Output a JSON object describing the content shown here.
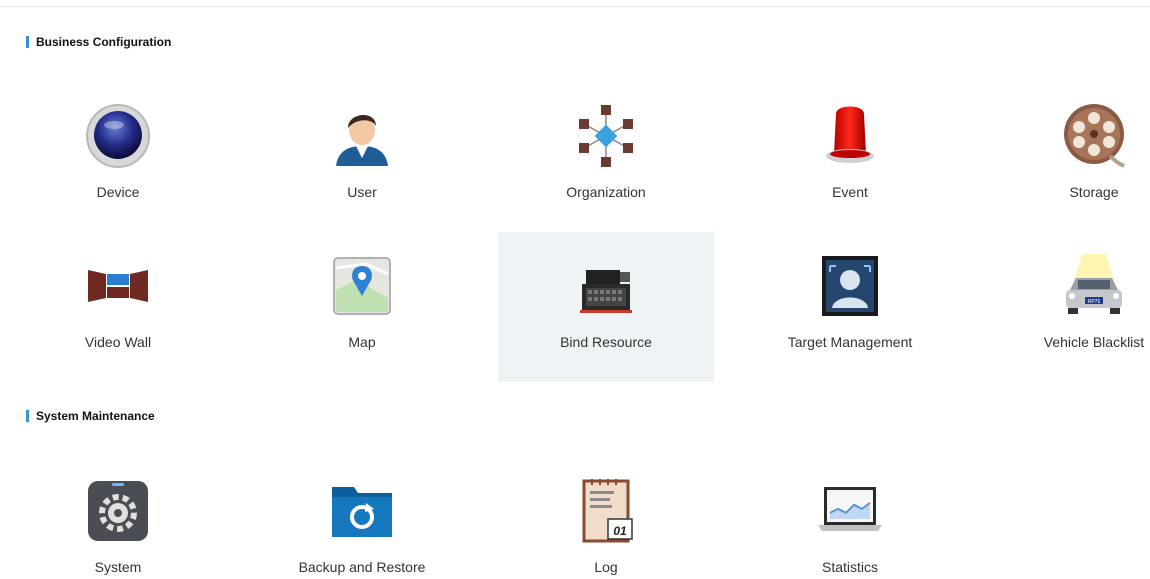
{
  "sections": {
    "business": {
      "title": "Business Configuration",
      "items": [
        {
          "label": "Device",
          "icon": "device-camera-icon"
        },
        {
          "label": "User",
          "icon": "user-icon"
        },
        {
          "label": "Organization",
          "icon": "organization-icon"
        },
        {
          "label": "Event",
          "icon": "alarm-light-icon"
        },
        {
          "label": "Storage",
          "icon": "film-reel-icon"
        },
        {
          "label": "Video Wall",
          "icon": "video-wall-icon"
        },
        {
          "label": "Map",
          "icon": "map-pin-icon"
        },
        {
          "label": "Bind Resource",
          "icon": "server-icon"
        },
        {
          "label": "Target Management",
          "icon": "face-target-icon"
        },
        {
          "label": "Vehicle Blacklist",
          "icon": "car-icon"
        }
      ]
    },
    "maintenance": {
      "title": "System Maintenance",
      "items": [
        {
          "label": "System",
          "icon": "gear-icon"
        },
        {
          "label": "Backup and Restore",
          "icon": "backup-folder-icon"
        },
        {
          "label": "Log",
          "icon": "log-notepad-icon"
        },
        {
          "label": "Statistics",
          "icon": "statistics-laptop-icon"
        }
      ]
    }
  },
  "selected_item": "Bind Resource",
  "vehicle_plate": "RP76",
  "log_date": "01",
  "colors": {
    "accent_bar": "#3b8fd8",
    "selected_tile_bg": "#eef3f6"
  }
}
